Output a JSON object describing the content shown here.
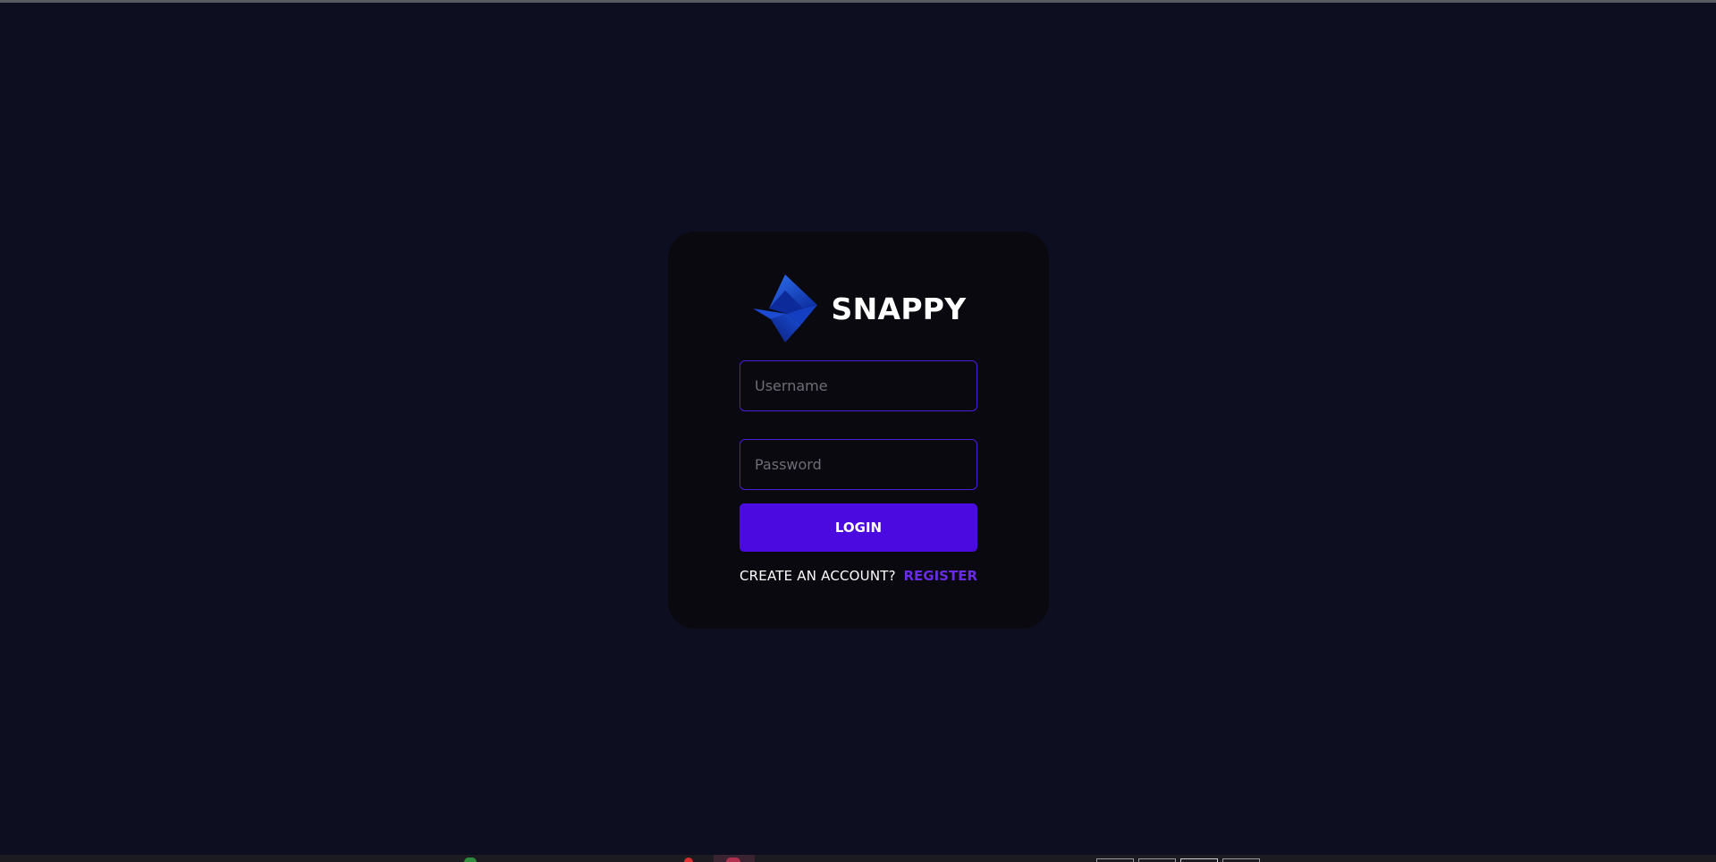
{
  "app": {
    "brand_name": "SNAPPY"
  },
  "login_form": {
    "username_placeholder": "Username",
    "username_value": "",
    "password_placeholder": "Password",
    "password_value": "",
    "login_label": "LOGIN",
    "account_prompt": "CREATE AN ACCOUNT?",
    "register_label": "REGISTER"
  },
  "theme": {
    "background": "#0d0e1f",
    "card_background": "#09090f",
    "accent": "#4b0ae0",
    "link_color": "#6a2be8",
    "input_border": "#4f1bd6",
    "logo_color": "#1f4fd6"
  },
  "icons": {
    "logo": "snappy-logo-icon"
  }
}
